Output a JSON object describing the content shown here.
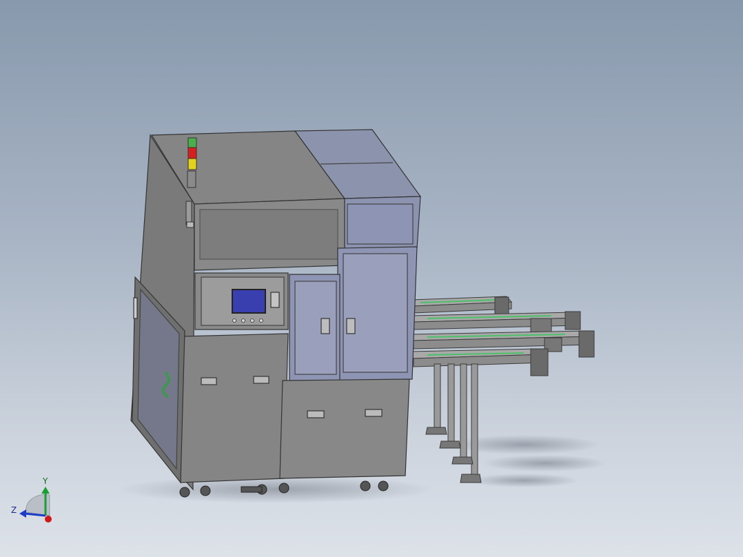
{
  "viewport": {
    "background_top": "#8899ad",
    "background_bottom": "#dde2e9"
  },
  "model": {
    "body_color": "#8a8a8a",
    "panel_color": "#7e7e7e",
    "window_tint": "#8890b0",
    "screen_color": "#3a3fb0",
    "signal_tower": [
      "green",
      "red",
      "yellow"
    ]
  },
  "triad": {
    "y_label": "Y",
    "z_label": "Z",
    "y_color": "#18a030",
    "z_color": "#1e3cc8",
    "x_color": "#d01818"
  }
}
